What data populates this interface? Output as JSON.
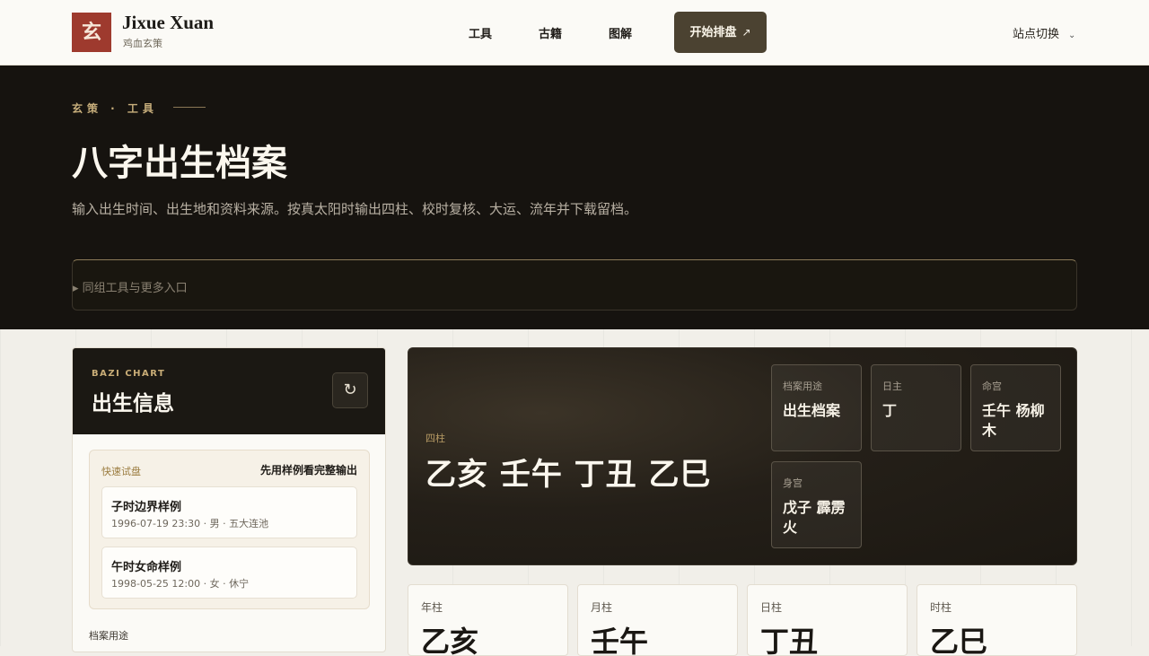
{
  "header": {
    "logo_glyph": "玄",
    "brand_name": "Jixue Xuan",
    "brand_sub": "鸡血玄策",
    "nav": [
      "工具",
      "古籍",
      "图解"
    ],
    "cta_label": "开始排盘",
    "cta_arrow": "↗",
    "site_switch": "站点切换",
    "site_switch_chevron": "⌄"
  },
  "hero": {
    "eyebrow": "玄策 · 工具",
    "title": "八字出生档案",
    "description": "输入出生时间、出生地和资料来源。按真太阳时输出四柱、校时复核、大运、流年并下载留档。",
    "details_label": "▸ 同组工具与更多入口"
  },
  "left_panel": {
    "eyebrow": "BAZI CHART",
    "title": "出生信息",
    "refresh_icon": "↻",
    "quick_label": "快速试盘",
    "quick_hint": "先用样例看完整输出",
    "samples": [
      {
        "title": "子时边界样例",
        "meta": "1996-07-19 23:30 · 男 · 五大连池"
      },
      {
        "title": "午时女命样例",
        "meta": "1998-05-25 12:00 · 女 · 休宁"
      }
    ],
    "purpose_label": "档案用途"
  },
  "chart_card": {
    "pillars_tag": "四柱",
    "pillars_value": "乙亥 壬午 丁丑 乙巳",
    "tiles": [
      {
        "label": "档案用途",
        "value": "出生档案"
      },
      {
        "label": "日主",
        "value": "丁"
      },
      {
        "label": "命宫",
        "value": "壬午 杨柳木"
      },
      {
        "label": "身宫",
        "value": "戊子 霹雳火"
      }
    ]
  },
  "pillars": [
    {
      "label": "年柱",
      "value": "乙亥"
    },
    {
      "label": "月柱",
      "value": "壬午"
    },
    {
      "label": "日柱",
      "value": "丁丑"
    },
    {
      "label": "时柱",
      "value": "乙巳"
    }
  ],
  "colors": {
    "accent_brown": "#4b4231",
    "logo_red": "#9e3a2e",
    "gold": "#c7ae7b",
    "hero_bg": "#16130f"
  }
}
